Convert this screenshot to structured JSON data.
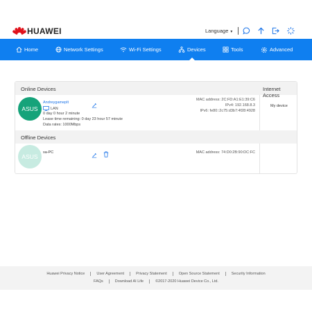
{
  "brand": {
    "name": "HUAWEI",
    "color": "#e0121b"
  },
  "header": {
    "language_label": "Language",
    "icons": [
      "chat-icon",
      "upload-arrow-icon",
      "logout-icon",
      "loading-icon"
    ]
  },
  "nav": {
    "accent": "#0f7ff0",
    "items": [
      {
        "label": "Home",
        "icon": "home-icon"
      },
      {
        "label": "Network Settings",
        "icon": "globe-icon"
      },
      {
        "label": "Wi-Fi Settings",
        "icon": "wifi-icon"
      },
      {
        "label": "Devices",
        "icon": "devices-icon",
        "active": true
      },
      {
        "label": "Tools",
        "icon": "tools-icon"
      },
      {
        "label": "Advanced",
        "icon": "gear-icon"
      }
    ]
  },
  "online": {
    "title": "Online Devices",
    "internet_access_header": "Internet Access",
    "device": {
      "avatar": "ASUS",
      "name": "Andreygameplt",
      "connection": "LAN",
      "online_time": "0 day 0 hour 2 minute",
      "lease": "Lease time remaining: 0 day 23 hour 57 minute",
      "data_rates": "Data rates:  1000Mbps",
      "mac": "MAC address: 2C:FD:A1:E1:39:C6",
      "ipv4": "IPv4: 192.168.8.3",
      "ipv6": "IPv6: fe80::2c75:d3b7:4f28:4928",
      "internet_access": "My device"
    }
  },
  "offline": {
    "title": "Offline Devices",
    "device": {
      "avatar": "ASUS",
      "name": "sa-PC",
      "mac": "MAC address: 74:D0:2B:90:DC:FC"
    }
  },
  "footer": {
    "row1": [
      "Huawei Privacy Notice",
      "User Agreement",
      "Privacy Statement",
      "Open Source Statement",
      "Security Information"
    ],
    "row2": [
      "FAQs",
      "Download AI Life",
      "©2017-2020 Huawei Device Co., Ltd."
    ]
  }
}
